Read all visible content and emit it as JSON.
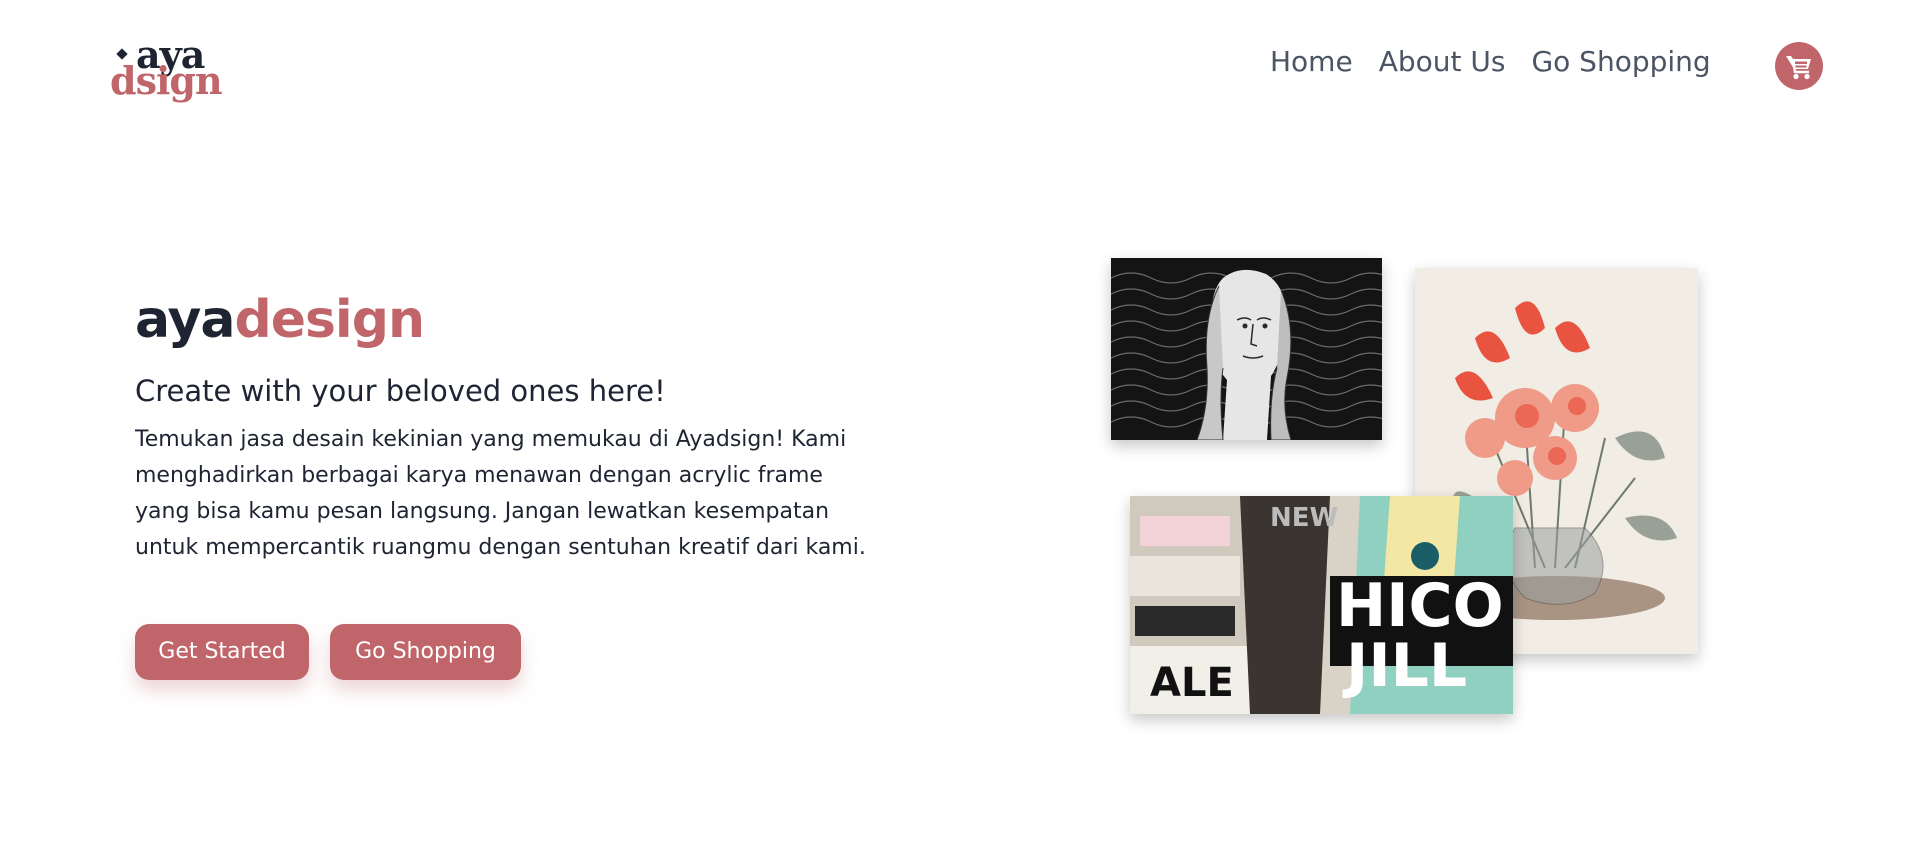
{
  "logo": {
    "line1": "aya",
    "line2": "dsign"
  },
  "nav": {
    "items": [
      "Home",
      "About Us",
      "Go Shopping"
    ]
  },
  "cart": {
    "icon": "cart-icon"
  },
  "hero": {
    "title_dark": "aya",
    "title_accent": "design",
    "subtitle": "Create with your beloved ones here!",
    "description": "Temukan jasa desain kekinian yang memukau di Ayadsign! Kami menghadirkan berbagai karya menawan dengan acrylic frame yang bisa kamu pesan langsung. Jangan lewatkan kesempatan untuk mempercantik ruangmu dengan sentuhan kreatif dari kami.",
    "buttons": {
      "primary": "Get Started",
      "secondary": "Go Shopping"
    }
  },
  "colors": {
    "accent": "#c0666b",
    "dark": "#1f2433",
    "nav_text": "#4b5563"
  },
  "artworks": {
    "portrait": {
      "icon": "engraving-portrait-artwork"
    },
    "flowers": {
      "icon": "flower-vase-artwork"
    },
    "collage": {
      "icon": "poster-collage-artwork"
    }
  }
}
